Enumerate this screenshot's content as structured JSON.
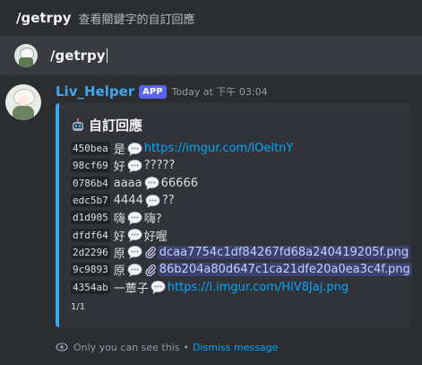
{
  "command_hint": {
    "command": "/getrpy",
    "description": "查看關鍵字的自訂回應"
  },
  "input": {
    "value": "/getrpy"
  },
  "message": {
    "username": "Liv_Helper",
    "badge": "APP",
    "timestamp": "Today at 下午 03:04",
    "embed": {
      "accent": "#3ea6f0",
      "title": "自訂回應",
      "rows": [
        {
          "id": "450bea",
          "keyword": "是",
          "type": "link",
          "value": "https://imgur.com/lOeltnY"
        },
        {
          "id": "98cf69",
          "keyword": "好",
          "type": "text",
          "value": "?????"
        },
        {
          "id": "0786b4",
          "keyword": "aaaa",
          "type": "text",
          "value": "66666"
        },
        {
          "id": "edc5b7",
          "keyword": "4444",
          "type": "text",
          "value": "??"
        },
        {
          "id": "d1d905",
          "keyword": "嗨",
          "type": "text",
          "value": "嗨?"
        },
        {
          "id": "dfdf64",
          "keyword": "好",
          "type": "text",
          "value": "好喔"
        },
        {
          "id": "2d2296",
          "keyword": "原",
          "type": "attachment",
          "value": "dcaa7754c1df84267fd68a240419205f.png"
        },
        {
          "id": "9c9893",
          "keyword": "原",
          "type": "attachment",
          "value": "86b204a80d647c1ca21dfe20a0ea3c4f.png"
        },
        {
          "id": "4354ab",
          "keyword": "一蕈子",
          "type": "link",
          "value": "https://i.imgur.com/HlV8Jaj.png"
        }
      ],
      "footer": "1/1"
    },
    "ephemeral_text": "Only you can see this",
    "separator": "•",
    "dismiss_label": "Dismiss message"
  }
}
